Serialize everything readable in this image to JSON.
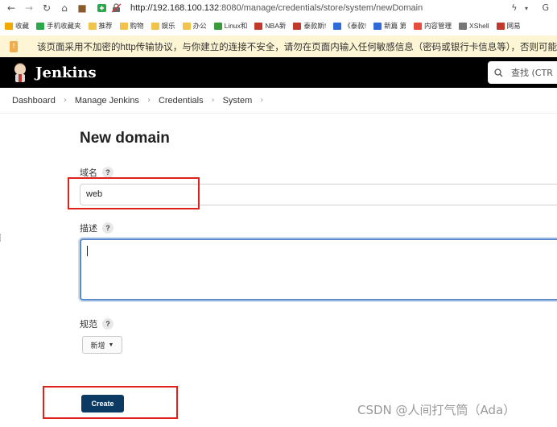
{
  "browser": {
    "url_host": "http://192.168.100.132",
    "url_path": ":8080/manage/credentials/store/system/newDomain",
    "bookmarks": [
      {
        "label": "收藏",
        "color": "#f2a900"
      },
      {
        "label": "手机收藏夹",
        "color": "#2aa84a"
      },
      {
        "label": "推荐",
        "color": "#f2c34b"
      },
      {
        "label": "购物",
        "color": "#f2c34b"
      },
      {
        "label": "娱乐",
        "color": "#f2c34b"
      },
      {
        "label": "办公",
        "color": "#f2c34b"
      },
      {
        "label": "Linux和",
        "color": "#3a9b3a"
      },
      {
        "label": "NBA新",
        "color": "#c0392b"
      },
      {
        "label": "泰款斯!",
        "color": "#c0392b"
      },
      {
        "label": "《泰款!",
        "color": "#2e6bd9"
      },
      {
        "label": "新篇 第",
        "color": "#2e6bd9"
      },
      {
        "label": "内容管理",
        "color": "#e74c3c"
      },
      {
        "label": "XShell",
        "color": "#777777"
      },
      {
        "label": "网易",
        "color": "#c0392b"
      }
    ],
    "warning": "该页面采用不加密的http传输协议，与你建立的连接不安全，请勿在页面内输入任何敏感信息（密码或银行卡信息等），否则可能"
  },
  "header": {
    "app_title": "Jenkins",
    "search_placeholder": "查找 (CTR"
  },
  "breadcrumb": [
    "Dashboard",
    "Manage Jenkins",
    "Credentials",
    "System"
  ],
  "form": {
    "title": "New domain",
    "domain_label": "域名",
    "domain_value": "web",
    "description_label": "描述",
    "spec_label": "规范",
    "add_label": "新增",
    "create_label": "Create",
    "help_mark": "?"
  },
  "watermark": "CSDN @人间打气筒（Ada）",
  "colors": {
    "header_bg": "#000000",
    "create_bg": "#0b3a63",
    "annotation": "#e0201b",
    "warning_bg": "#fdf5d3"
  }
}
